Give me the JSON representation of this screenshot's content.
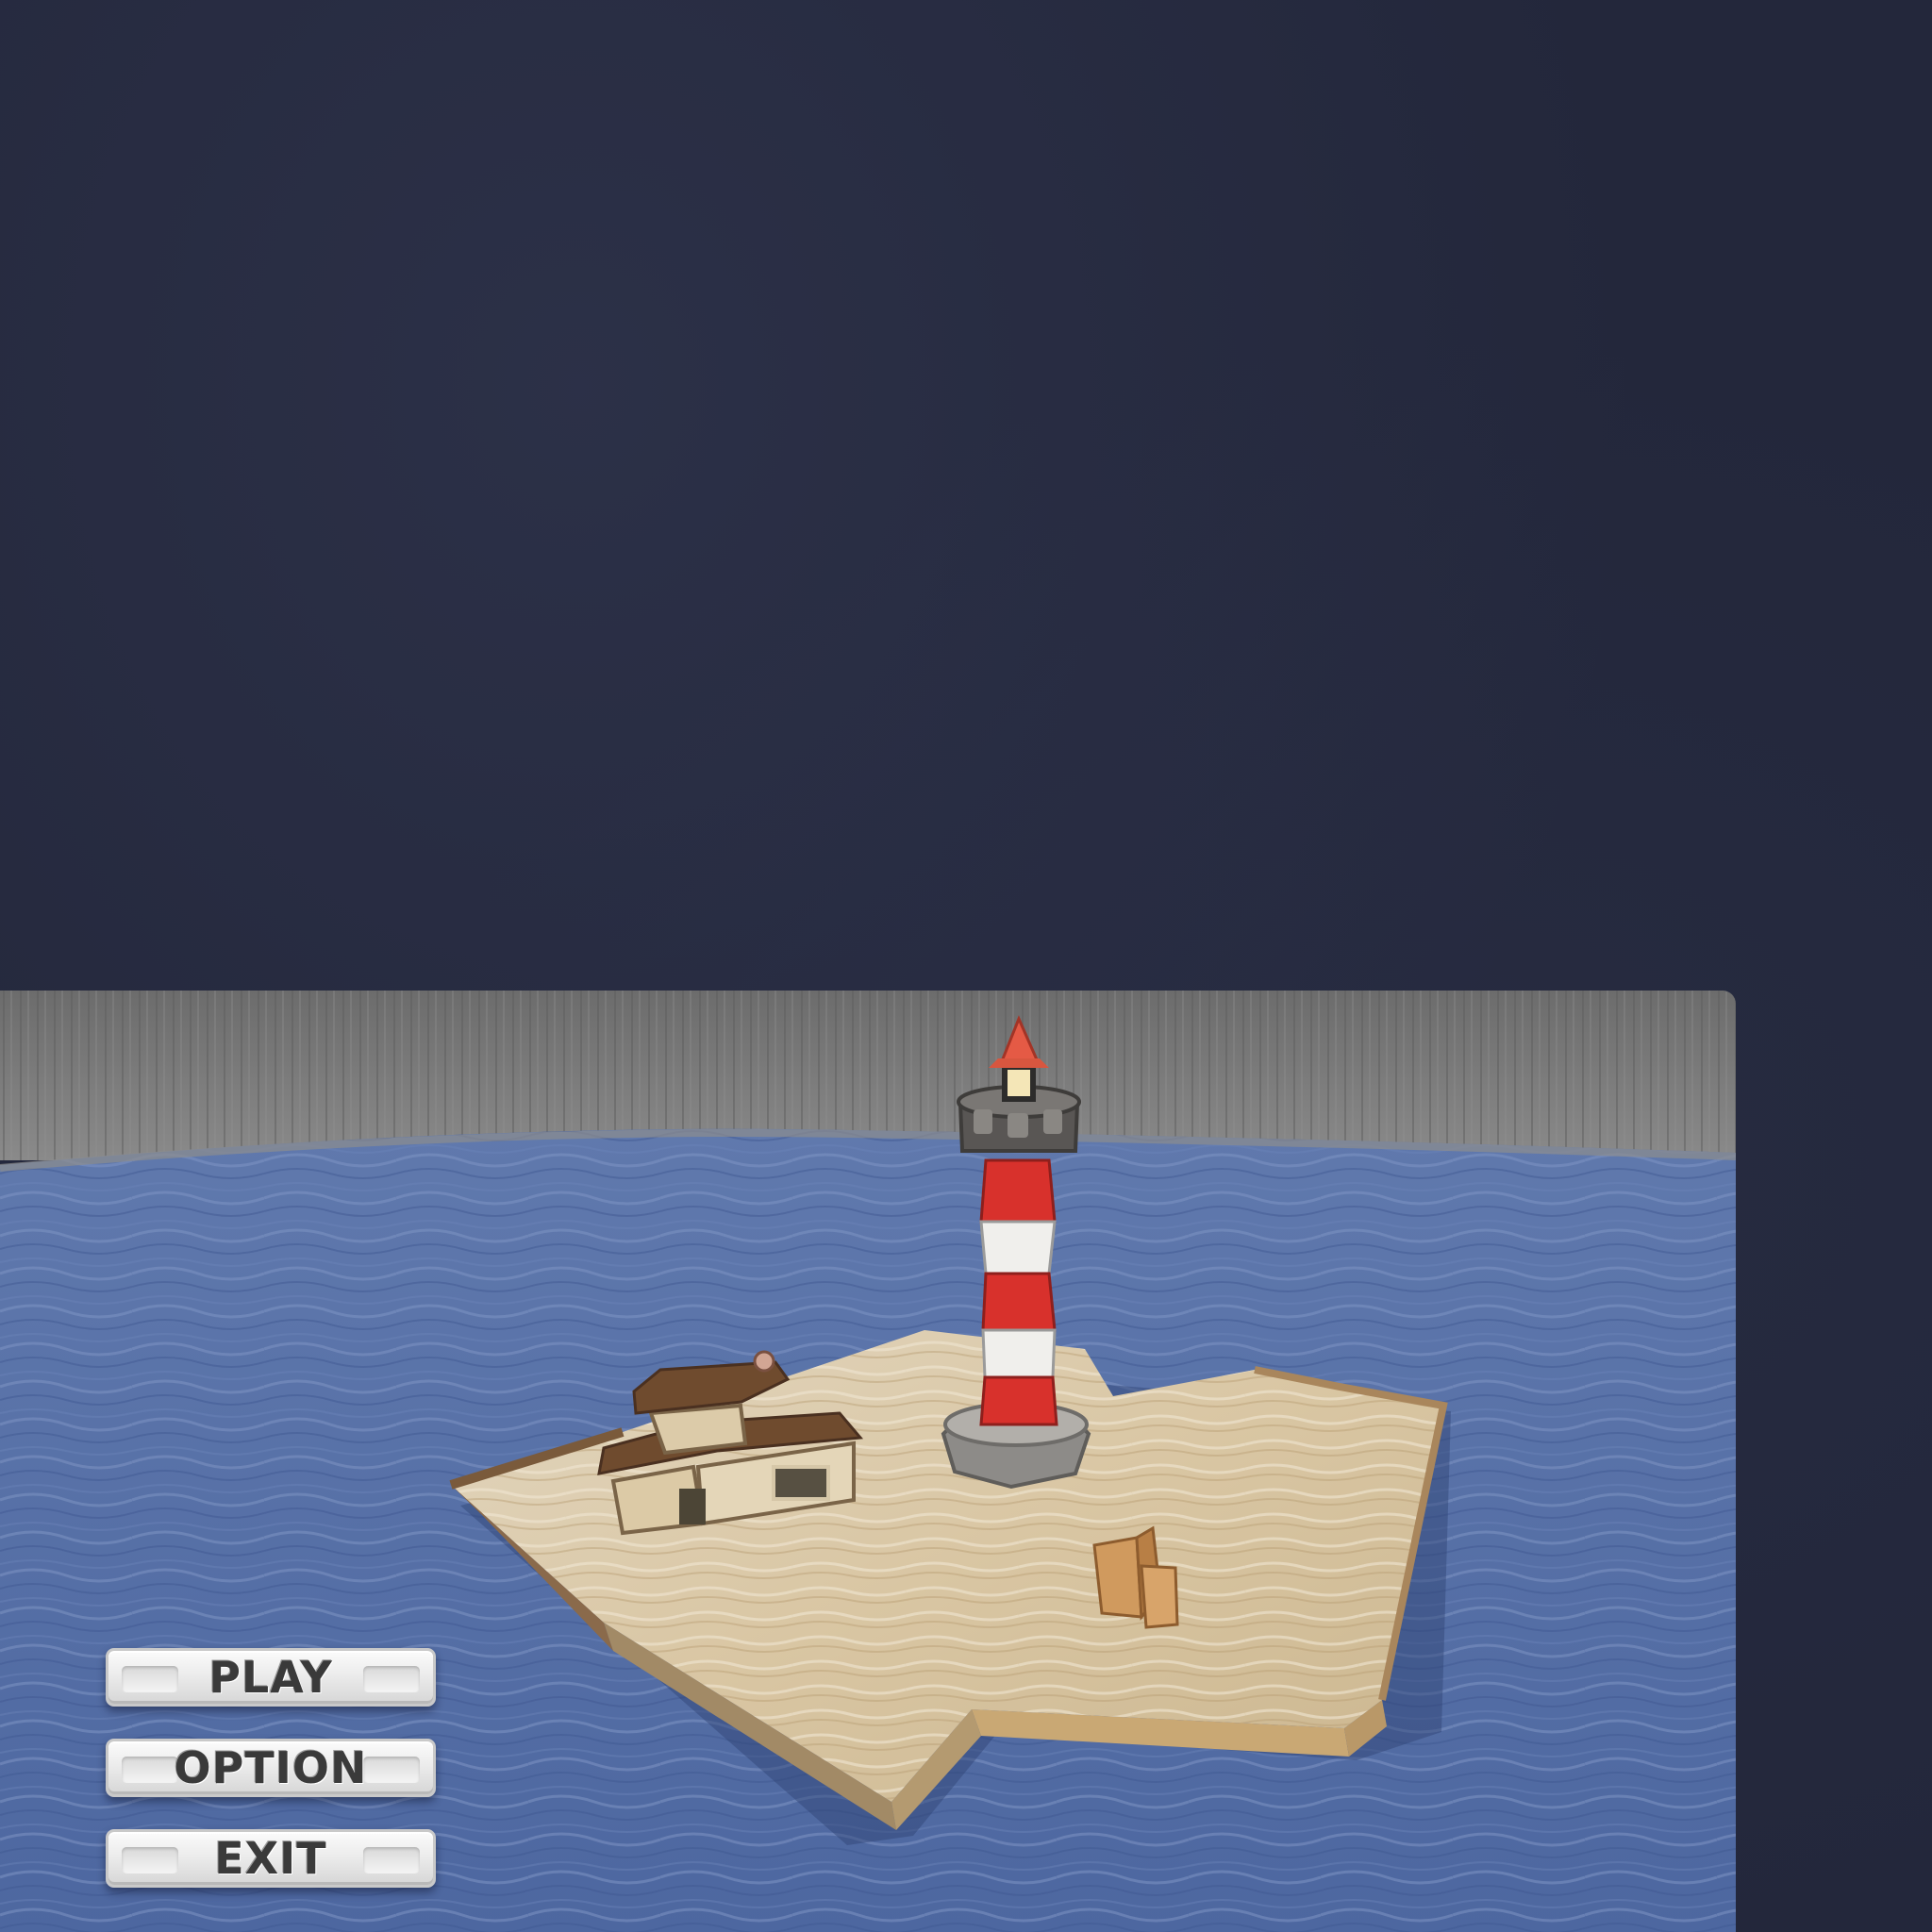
{
  "menu": {
    "play_label": "PLAY",
    "option_label": "OPTION",
    "exit_label": "EXIT"
  },
  "colors": {
    "background": "#23273b",
    "sea": "#5670a6",
    "sky_wall": "#7a7a7a",
    "island": "#d7c6a6",
    "lighthouse_red": "#d8312c",
    "lighthouse_white": "#efefef",
    "roof_brown": "#6e4a2e",
    "button_face": "#eeeeee",
    "button_text": "#3a3a3a"
  },
  "icons": {
    "lighthouse": "lighthouse-icon",
    "house": "house-icon",
    "crates": "crate-icon"
  }
}
